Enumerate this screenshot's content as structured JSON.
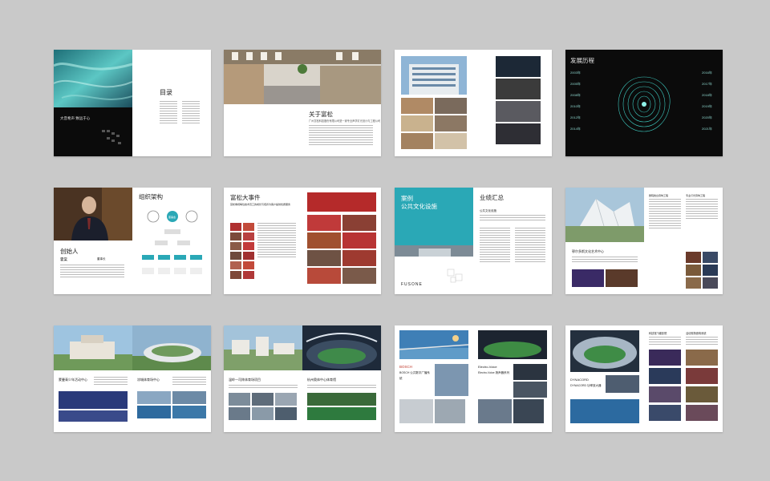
{
  "spreads": {
    "cover": {
      "slogan": "大音希声  致远于心"
    },
    "toc": {
      "title": "目录"
    },
    "about": {
      "title": "关于富松",
      "intro": "广州富松科技股份有限公司是一家专业声学灯光设计与工程公司"
    },
    "history": {
      "title": "发展历程",
      "years_left": [
        "2003年",
        "2005年",
        "2008年",
        "2010年",
        "2012年",
        "2014年"
      ],
      "years_right": [
        "2016年",
        "2017年",
        "2018年",
        "2019年",
        "2020年",
        "2021年"
      ]
    },
    "founder": {
      "title": "创始人",
      "name": "霍棠",
      "role": "董事长",
      "org_title": "组织架构",
      "org_center": "董事会"
    },
    "events": {
      "title": "富松大事件",
      "subtitle": "富松重视每位技术员工的成长与培养为客户提供优质服务"
    },
    "cases": {
      "title": "案例",
      "subtitle": "公共文化设施",
      "brand": "FUSONE",
      "perf_title": "业绩汇总",
      "perf_sub": "公共文化设施"
    },
    "culture_center": {
      "venue": "鄂尔多斯文化艺术中心",
      "col_a": "剧院舞台音响工程",
      "col_b": "专业灯光音响工程"
    },
    "youth_center": {
      "venue_a": "蒙曼青少年活动中心",
      "venue_b": "凉城体育场中心"
    },
    "sports": {
      "venue_a": "温岭一司阵体育场项目",
      "venue_b": "杭州奥体中心体育馆"
    },
    "bosch": {
      "brand": "BOSCH",
      "caption_a": "BOSCH 公共数字广播系统",
      "ev_brand": "Electro-Voice",
      "caption_b": "Electro-Voice 扬声器系列"
    },
    "dynacord": {
      "brand": "DYNACORD",
      "caption": "DYNACORD 功率放大器",
      "head_a": "科技馆飞碟影院",
      "head_b": "活动现场音响系统"
    }
  }
}
